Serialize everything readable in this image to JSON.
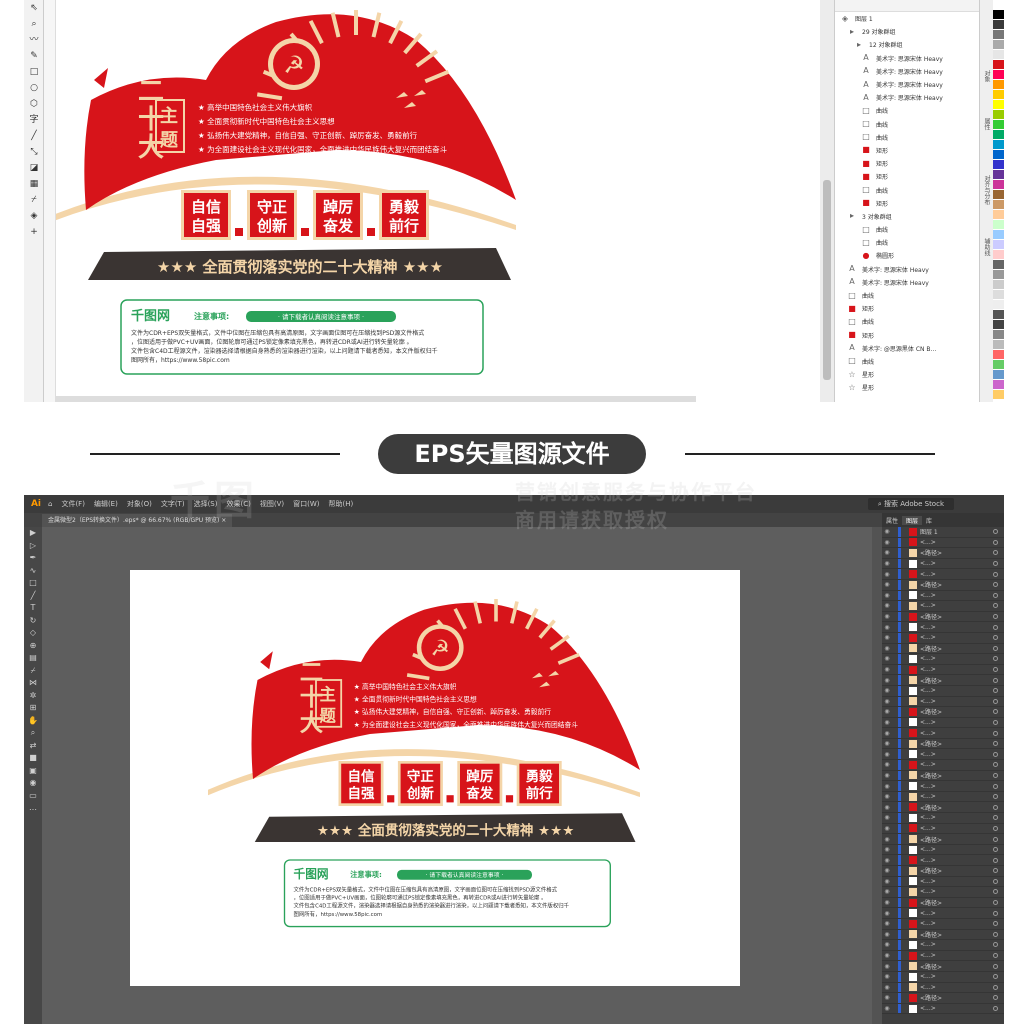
{
  "banner": {
    "label": "EPS矢量图源文件"
  },
  "design": {
    "theme_chars": [
      "二",
      "十",
      "大"
    ],
    "theme_box": [
      "主",
      "题"
    ],
    "bullets": [
      "高举中国特色社会主义伟大旗帜",
      "全面贯彻新时代中国特色社会主义思想",
      "弘扬伟大建党精神，自信自强、守正创新、踔厉奋发、勇毅前行",
      "为全面建设社会主义现代化国家，全面推进中华民族伟大复兴而团结奋斗"
    ],
    "blocks": [
      {
        "line1": "自信",
        "line2": "自强"
      },
      {
        "line1": "守正",
        "line2": "创新"
      },
      {
        "line1": "踔厉",
        "line2": "奋发"
      },
      {
        "line1": "勇毅",
        "line2": "前行"
      }
    ],
    "slogan": "★★★ 全面贯彻落实党的二十大精神 ★★★",
    "notice": {
      "brand": "千图网",
      "title": "注意事项:",
      "pill": "· 请下载者认真阅读注意事项 ·",
      "body": "文件为CDR+EPS双矢量格式，文件中位图在压缩包具有高清原图，文字画面位图可在压缩找到PSD源文件格式，位图适用于做PVC+UV画面，位图轮廓可通过PS锁定像素填充黑色，再转进CDR或AI进行转矢量轮廓 。文件包含C4D工程源文件，渲染器选择请根据自身熟悉的渲染器进行渲染，以上问题请下载者悉知，本文件版权归千图网所有，https://www.58pic.com"
    }
  },
  "coreldraw": {
    "layers": [
      {
        "icon": "layer",
        "indent": 0,
        "label": "图层 1"
      },
      {
        "icon": "group",
        "indent": 1,
        "label": "29 对象群组"
      },
      {
        "icon": "group",
        "indent": 2,
        "label": "12 对象群组"
      },
      {
        "icon": "text",
        "indent": 3,
        "label": "美术字: 思源宋体 Heavy"
      },
      {
        "icon": "text",
        "indent": 3,
        "label": "美术字: 思源宋体 Heavy"
      },
      {
        "icon": "text",
        "indent": 3,
        "label": "美术字: 思源宋体 Heavy"
      },
      {
        "icon": "text",
        "indent": 3,
        "label": "美术字: 思源宋体 Heavy"
      },
      {
        "icon": "curve",
        "indent": 3,
        "label": "曲线"
      },
      {
        "icon": "curve",
        "indent": 3,
        "label": "曲线"
      },
      {
        "icon": "curve",
        "indent": 3,
        "label": "曲线"
      },
      {
        "icon": "rect",
        "indent": 3,
        "label": "矩形"
      },
      {
        "icon": "rect",
        "indent": 3,
        "label": "矩形"
      },
      {
        "icon": "rect",
        "indent": 3,
        "label": "矩形"
      },
      {
        "icon": "curve",
        "indent": 3,
        "label": "曲线"
      },
      {
        "icon": "rect",
        "indent": 3,
        "label": "矩形"
      },
      {
        "icon": "group",
        "indent": 1,
        "label": "3 对象群组"
      },
      {
        "icon": "curve",
        "indent": 3,
        "label": "曲线"
      },
      {
        "icon": "curve",
        "indent": 3,
        "label": "曲线"
      },
      {
        "icon": "ellipse",
        "indent": 3,
        "label": "椭圆形"
      },
      {
        "icon": "text",
        "indent": 1,
        "label": "美术字: 思源宋体 Heavy"
      },
      {
        "icon": "text",
        "indent": 1,
        "label": "美术字: 思源宋体 Heavy"
      },
      {
        "icon": "curve",
        "indent": 1,
        "label": "曲线"
      },
      {
        "icon": "rect",
        "indent": 1,
        "label": "矩形"
      },
      {
        "icon": "curve",
        "indent": 1,
        "label": "曲线"
      },
      {
        "icon": "rect",
        "indent": 1,
        "label": "矩形"
      },
      {
        "icon": "text",
        "indent": 1,
        "label": "美术字: @思源黑体 CN B..."
      },
      {
        "icon": "curve",
        "indent": 1,
        "label": "曲线"
      },
      {
        "icon": "star",
        "indent": 1,
        "label": "星形"
      },
      {
        "icon": "star",
        "indent": 1,
        "label": "星形"
      }
    ],
    "side_tabs": [
      "对象",
      "属性",
      "对齐与分布",
      "辅助线"
    ]
  },
  "illustrator": {
    "menu": [
      "文件(F)",
      "编辑(E)",
      "对象(O)",
      "文字(T)",
      "选择(S)",
      "效果(C)",
      "视图(V)",
      "窗口(W)",
      "帮助(H)"
    ],
    "search_placeholder": "搜索 Adobe Stock",
    "tab_label": "金属微型2（EPS转换文件）.eps* @ 66.67% (RGB/GPU 预览)",
    "panel_tabs": [
      "属性",
      "图层",
      "库"
    ],
    "layer_name": "图层 1",
    "path_label": "<路径>",
    "ellipsis_label": "<...>"
  },
  "watermark": {
    "brand": "千图",
    "line1": "营销创意服务与协作平台",
    "line2": "商用请获取授权"
  },
  "colors": {
    "red": "#d7141a",
    "gold": "#f4d5a8",
    "dark": "#3a3432",
    "green": "#2aa25a"
  }
}
